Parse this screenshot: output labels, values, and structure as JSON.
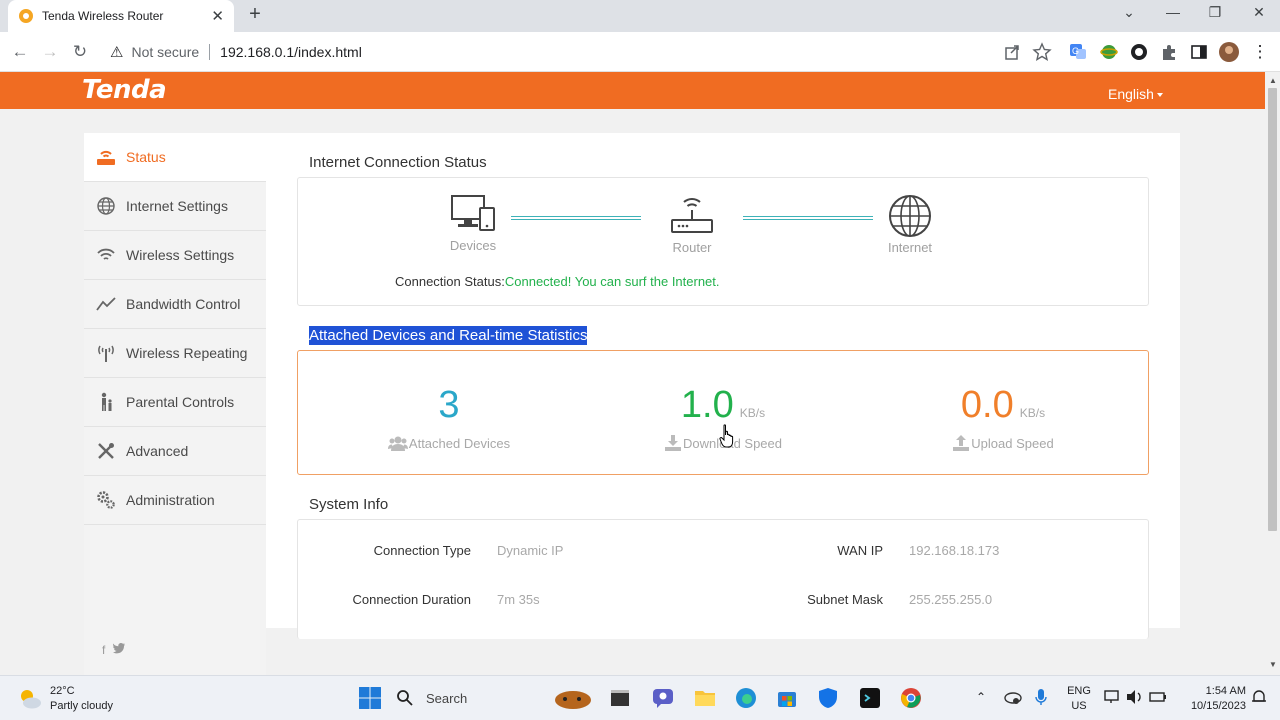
{
  "browser": {
    "tab_title": "Tenda Wireless Router",
    "security_label": "Not secure",
    "url": "192.168.0.1/index.html"
  },
  "header": {
    "logo": "Tenda",
    "language": "English",
    "brand_color": "#f06c22"
  },
  "sidebar": {
    "items": [
      {
        "label": "Status",
        "icon": "router-icon",
        "active": true
      },
      {
        "label": "Internet Settings",
        "icon": "globe-icon"
      },
      {
        "label": "Wireless Settings",
        "icon": "wifi-icon"
      },
      {
        "label": "Bandwidth Control",
        "icon": "trend-icon"
      },
      {
        "label": "Wireless Repeating",
        "icon": "antenna-icon"
      },
      {
        "label": "Parental Controls",
        "icon": "family-icon"
      },
      {
        "label": "Advanced",
        "icon": "tools-icon"
      },
      {
        "label": "Administration",
        "icon": "gears-icon"
      }
    ],
    "social": [
      "f",
      "twitter"
    ]
  },
  "connection": {
    "section_title": "Internet Connection Status",
    "devices_label": "Devices",
    "router_label": "Router",
    "internet_label": "Internet",
    "status_key": "Connection Status:",
    "status_value": "Connected! You can surf the Internet."
  },
  "stats": {
    "section_title": "Attached Devices and Real-time Statistics",
    "attached": {
      "value": "3",
      "label": "Attached Devices",
      "color": "#2aa7c9"
    },
    "download": {
      "value": "1.0",
      "unit": "KB/s",
      "label": "Download Speed",
      "color": "#22b14c"
    },
    "upload": {
      "value": "0.0",
      "unit": "KB/s",
      "label": "Upload Speed",
      "color": "#f07f2a"
    }
  },
  "system": {
    "section_title": "System Info",
    "rows": [
      {
        "k1": "Connection Type",
        "v1": "Dynamic IP",
        "k2": "WAN IP",
        "v2": "192.168.18.173"
      },
      {
        "k1": "Connection Duration",
        "v1": "7m 35s",
        "k2": "Subnet Mask",
        "v2": "255.255.255.0"
      }
    ]
  },
  "taskbar": {
    "temperature": "22°C",
    "weather": "Partly cloudy",
    "search": "Search",
    "lang1": "ENG",
    "lang2": "US",
    "time": "1:54 AM",
    "date": "10/15/2023"
  }
}
